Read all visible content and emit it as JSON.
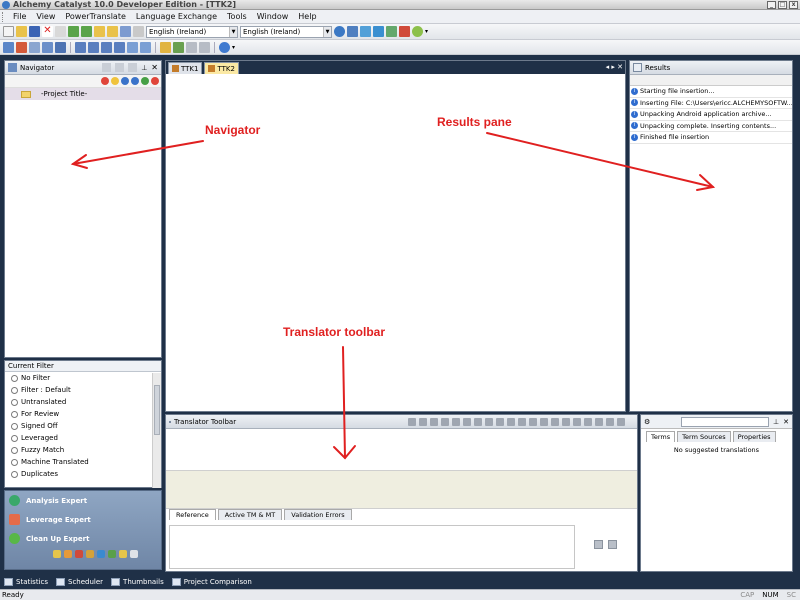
{
  "window": {
    "title": "Alchemy Catalyst 10.0 Developer Edition - [TTK2]"
  },
  "menu": [
    "File",
    "View",
    "PowerTranslate",
    "Language Exchange",
    "Tools",
    "Window",
    "Help"
  ],
  "toolbar": {
    "source_language": "English (Ireland)",
    "target_language": "English (Ireland)"
  },
  "navigator": {
    "title": "Navigator",
    "project_title": "-Project Title-"
  },
  "editor": {
    "tabs": [
      "TTK1",
      "TTK2"
    ],
    "active_tab": "TTK2"
  },
  "results": {
    "title": "Results",
    "rows": [
      "Starting file insertion...",
      "Inserting File:  C:\\Users\\ericc.ALCHEMYSOFTW...",
      "Unpacking Android application archive...",
      "Unpacking complete.  Inserting contents...",
      "Finished file insertion"
    ]
  },
  "filter": {
    "title": "Current Filter",
    "items": [
      "No Filter",
      "Filter : Default",
      "Untranslated",
      "For Review",
      "Signed Off",
      "Leveraged",
      "Fuzzy Match",
      "Machine Translated",
      "Duplicates"
    ]
  },
  "experts": {
    "items": [
      "Analysis Expert",
      "Leverage Expert",
      "Clean Up Expert"
    ]
  },
  "translator": {
    "title": "Translator Toolbar",
    "tabs": [
      "Reference",
      "Active TM & MT",
      "Validation Errors"
    ]
  },
  "terms": {
    "tabs": [
      "Terms",
      "Term Sources",
      "Properties"
    ],
    "empty_message": "No suggested translations"
  },
  "taskbar": {
    "items": [
      "Statistics",
      "Scheduler",
      "Thumbnails",
      "Project Comparison"
    ]
  },
  "statusbar": {
    "status": "Ready",
    "indicators": [
      "CAP",
      "NUM",
      "SC"
    ]
  },
  "annotations": {
    "navigator": "Navigator",
    "results": "Results pane",
    "translator": "Translator toolbar"
  },
  "colors": {
    "annotation": "#e02020",
    "dock_background": "#1f3047",
    "active_tab": "#fbe9a4"
  }
}
